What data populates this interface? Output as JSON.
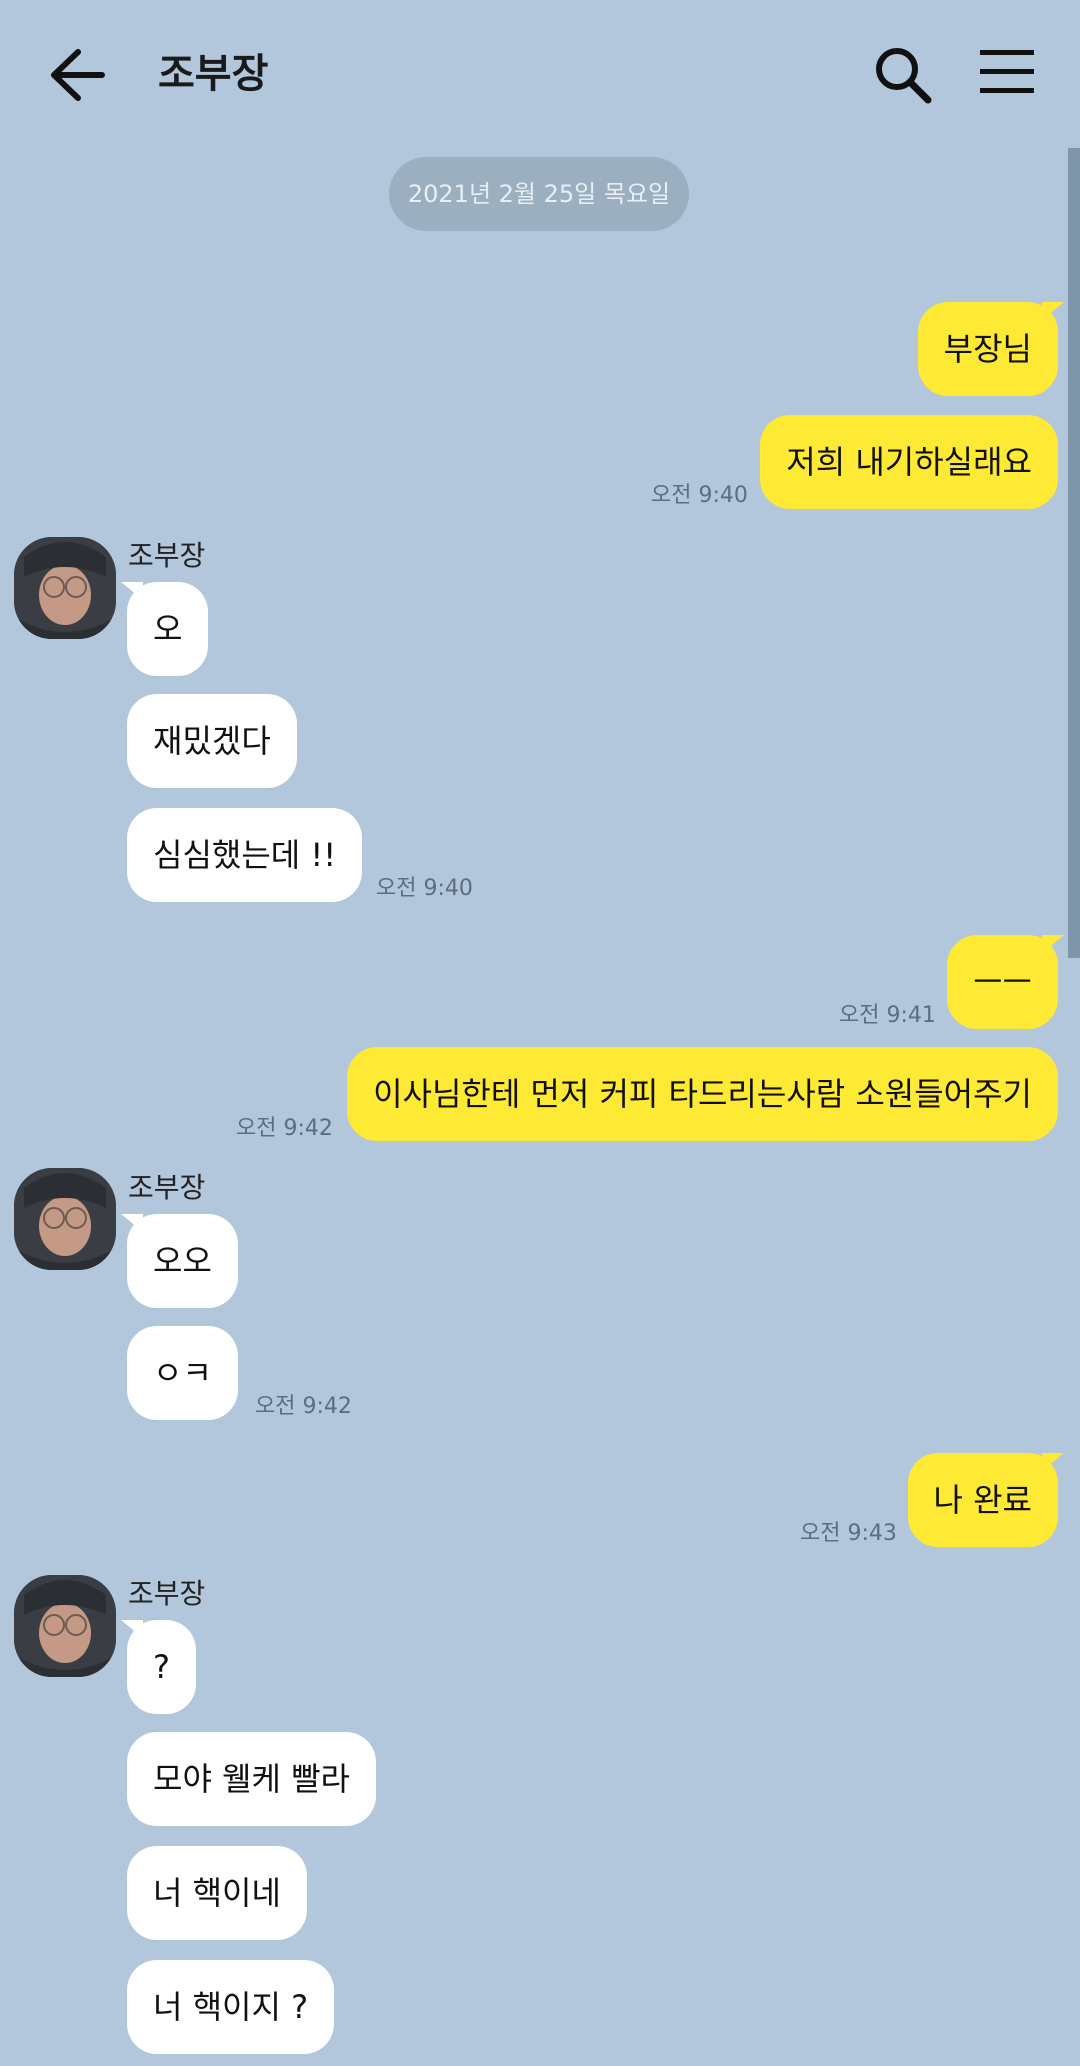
{
  "header": {
    "title": "조부장"
  },
  "date_divider": "2021년 2월 25일 목요일",
  "messages": {
    "m1": "부장님",
    "m2": "저희 내기하실래요",
    "m2_time": "오전 9:40",
    "g1_sender": "조부장",
    "m3": "오",
    "m4": "재밌겠다",
    "m5": "심심했는데 !!",
    "m5_time": "오전 9:40",
    "m6": "ㅡㅡ",
    "m6_time": "오전 9:41",
    "m7": "이사님한테 먼저 커피 타드리는사람 소원들어주기",
    "m7_time": "오전 9:42",
    "g2_sender": "조부장",
    "m8": "오오",
    "m9": "ㅇㅋ",
    "m9_time": "오전 9:42",
    "m10": "나 완료",
    "m10_time": "오전 9:43",
    "g3_sender": "조부장",
    "m11": "?",
    "m12": "모야 웰케 빨라",
    "m13": "너 핵이네",
    "m14": "너 핵이지 ?"
  },
  "colors": {
    "background": "#b2c7dc",
    "my_bubble": "#fee934",
    "their_bubble": "#ffffff"
  },
  "icons": {
    "back": "arrow-left-icon",
    "search": "search-icon",
    "menu": "hamburger-menu-icon"
  }
}
